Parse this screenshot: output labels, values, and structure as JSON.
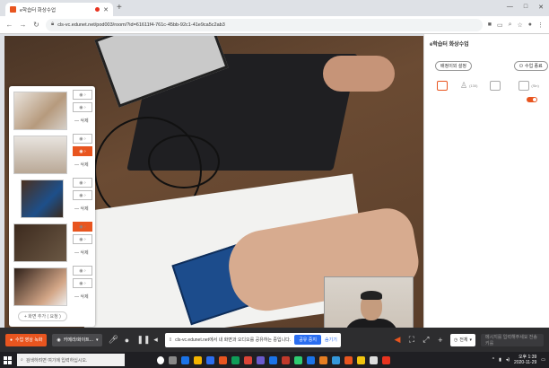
{
  "browser": {
    "tab_title": "e학습터 화상수업",
    "new_tab": "+",
    "url": "cls-vc.edunet.net/pod003/room/?id=61611f4-761c-45bb-92c1-41e9ca5c2ab3",
    "lock_icon": "lock-icon",
    "window_controls": [
      "—",
      "□",
      "✕"
    ]
  },
  "thumbnails": {
    "items": [
      {
        "delete_label": "— 삭제",
        "active": false
      },
      {
        "delete_label": "— 삭제",
        "active": true
      },
      {
        "delete_label": "— 삭제",
        "active": false
      },
      {
        "delete_label": "— 삭제",
        "active": false
      },
      {
        "delete_label": "— 삭제",
        "active": false
      }
    ],
    "add_label": "+ 화면 추가 ( 요청 )"
  },
  "side": {
    "title": "e학습터 화상수업",
    "btn_left": "배정이외 설정",
    "btn_right": "수업 종료",
    "participants_count": "(130)",
    "screen_label": "(Sin)"
  },
  "controls": {
    "record_label": "수업 영상 녹화",
    "camera_label": "카메라/화이트...",
    "share_text": "cls-vc.edunet.net에서 내 화면과 오디오를 공유하는 중입니다.",
    "share_stop": "공유 중지",
    "hide_label": "숨기기",
    "all_label": "전체",
    "chat_placeholder": "메시지를 입력해주세요 전송키를"
  },
  "taskbar": {
    "search_placeholder": "검색하려면 여기에 입력하십시오.",
    "time": "오후 1:39",
    "date": "2020-11-29"
  },
  "colors": {
    "accent": "#e8551f",
    "share_blue": "#2b6ef0",
    "control_bar": "#2d2d2f"
  }
}
